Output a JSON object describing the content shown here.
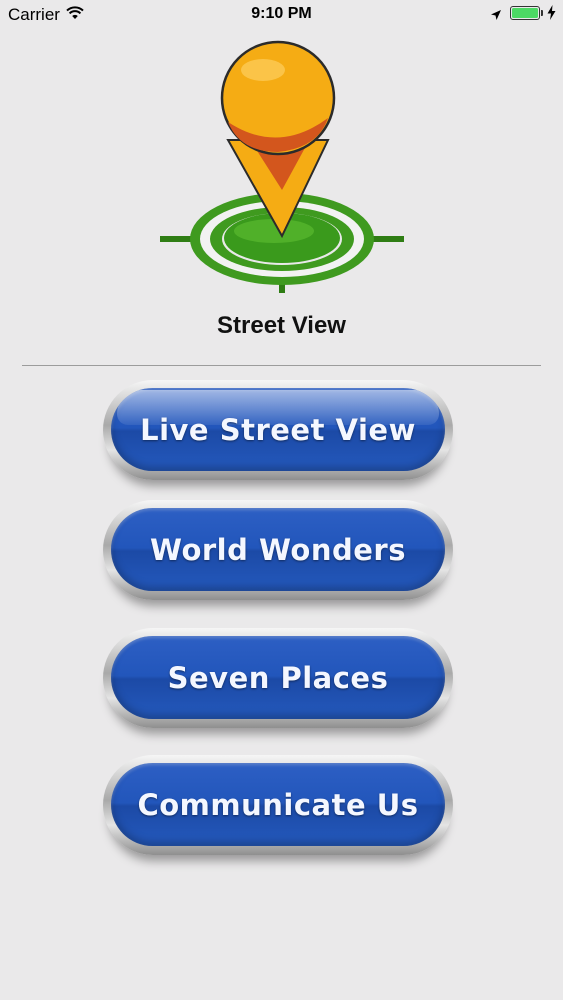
{
  "status_bar": {
    "carrier": "Carrier",
    "time": "9:10 PM",
    "battery_level": 1.0,
    "battery_color": "#4cd964"
  },
  "logo": {
    "icon": "map-pin-target-icon",
    "colors": {
      "pin": "#f5ac14",
      "pin_shadow": "#d3561d",
      "target": "#3f9a1f"
    }
  },
  "header": {
    "title": "Street View"
  },
  "menu": {
    "items": [
      {
        "label": "Live Street View"
      },
      {
        "label": "World Wonders"
      },
      {
        "label": "Seven Places"
      },
      {
        "label": "Communicate Us"
      }
    ],
    "button_color": "#2256bb"
  }
}
